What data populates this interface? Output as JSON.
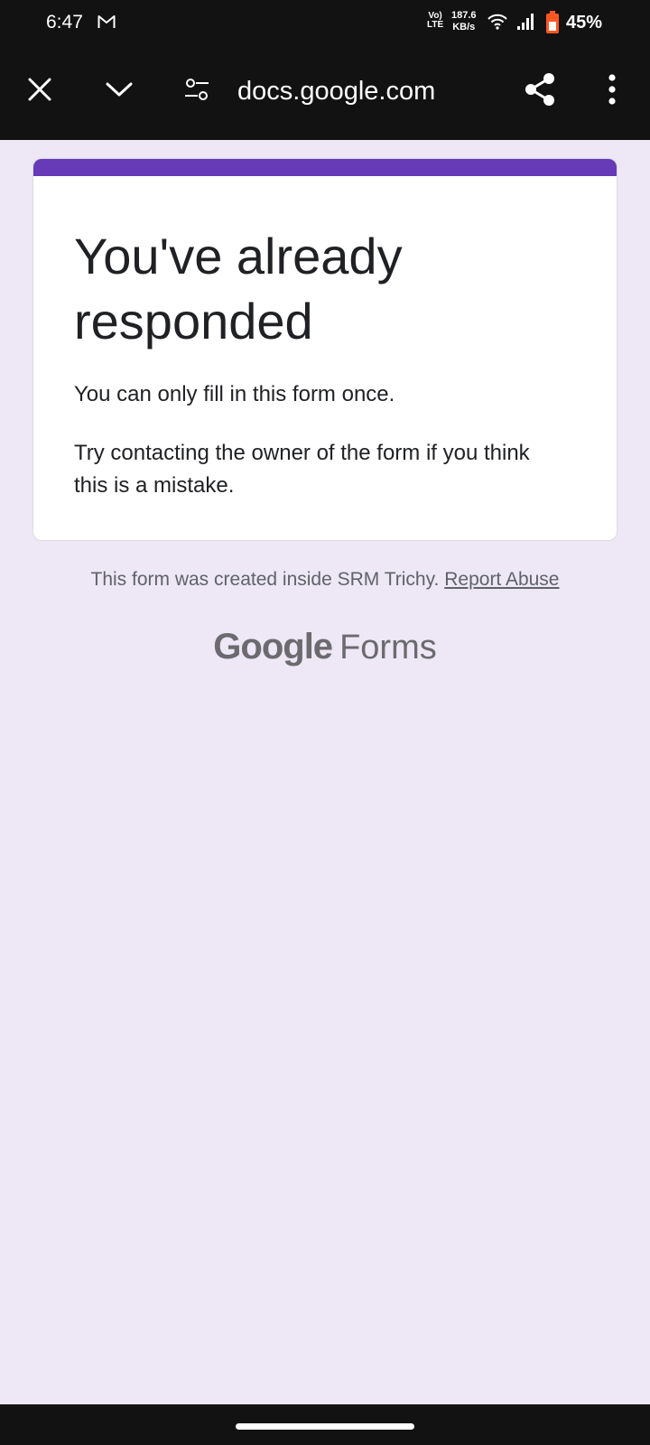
{
  "status_bar": {
    "time": "6:47",
    "network_top": "Vo)",
    "network_bottom": "LTE",
    "speed_value": "187.6",
    "speed_unit": "KB/s",
    "battery": "45%"
  },
  "toolbar": {
    "url": "docs.google.com"
  },
  "card": {
    "title": "You've already responded",
    "line1": "You can only fill in this form once.",
    "line2": "Try contacting the owner of the form if you think this is a mistake.",
    "accent_color": "#673ab7"
  },
  "footer": {
    "created_text": "This form was created inside SRM Trichy.",
    "report_link": "Report Abuse",
    "brand_google": "Google",
    "brand_forms": "Forms"
  },
  "colors": {
    "page_background": "#ede7f6",
    "chrome_background": "#121212"
  },
  "icons": [
    "gmail-icon",
    "wifi-icon",
    "signal-icon",
    "battery-icon",
    "close-icon",
    "chevron-down-icon",
    "site-settings-icon",
    "share-icon",
    "more-vert-icon"
  ]
}
